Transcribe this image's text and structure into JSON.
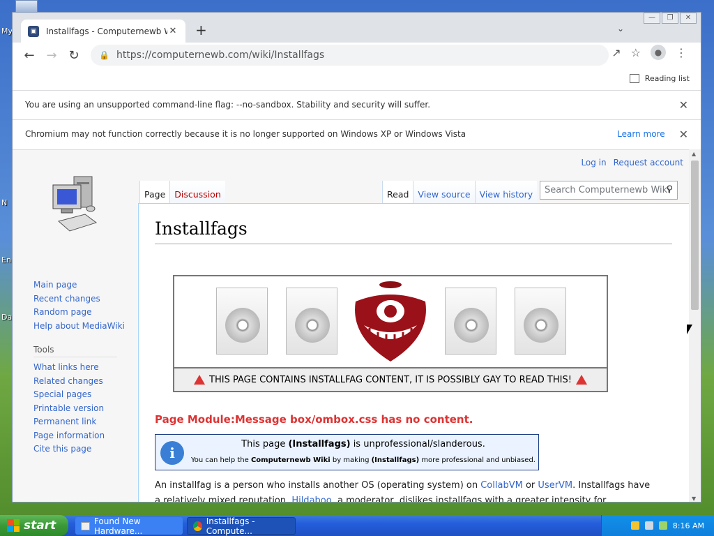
{
  "desktop": {
    "labels": [
      "My",
      "N",
      "En",
      "Da"
    ]
  },
  "window": {
    "tab_title": "Installfags - Computernewb Wiki",
    "url": "https://computernewb.com/wiki/Installfags",
    "reading_list": "Reading list",
    "infobar_sandbox": "You are using an unsupported command-line flag: --no-sandbox. Stability and security will suffer.",
    "infobar_xp": "Chromium may not function correctly because it is no longer supported on Windows XP or Windows Vista",
    "learn_more": "Learn more"
  },
  "wiki": {
    "personal": {
      "login": "Log in",
      "request": "Request account"
    },
    "tabs_left": [
      "Page",
      "Discussion"
    ],
    "tabs_right": [
      "Read",
      "View source",
      "View history"
    ],
    "search_placeholder": "Search Computernewb Wiki",
    "nav": [
      "Main page",
      "Recent changes",
      "Random page",
      "Help about MediaWiki"
    ],
    "tools_heading": "Tools",
    "tools": [
      "What links here",
      "Related changes",
      "Special pages",
      "Printable version",
      "Permanent link",
      "Page information",
      "Cite this page"
    ],
    "title": "Installfags",
    "banner_caption": "THIS PAGE CONTAINS INSTALLFAG CONTENT, IT IS POSSIBLY GAY TO READ THIS!",
    "error_prefix": "Page ",
    "error_module": "Module:Message box/ombox.css",
    "error_suffix": " has no content.",
    "ambox_line1_a": "This page ",
    "ambox_line1_b": "(Installfags)",
    "ambox_line1_c": " is unprofessional/slanderous.",
    "ambox_line2_a": "You can help the ",
    "ambox_line2_b": "Computernewb Wiki",
    "ambox_line2_c": " by making ",
    "ambox_line2_d": "(Installfags)",
    "ambox_line2_e": " more professional and unbiased.",
    "para_a": "An installfag is a person who installs another OS (operating system) on ",
    "para_link1": "CollabVM",
    "para_or": " or ",
    "para_link2": "UserVM",
    "para_b": ". Installfags have a relatively mixed reputation. ",
    "para_link3": "Hildaboo",
    "para_c": ", a moderator, dislikes installfags with a greater intensity for repetitiveness"
  },
  "taskbar": {
    "start": "start",
    "item1": "Found New Hardware...",
    "item2": "Installfags - Compute...",
    "clock": "8:16 AM"
  },
  "colors": {
    "link": "#3366cc",
    "error": "#d33",
    "xp_blue": "#245edc",
    "start_green": "#3a9a36"
  }
}
